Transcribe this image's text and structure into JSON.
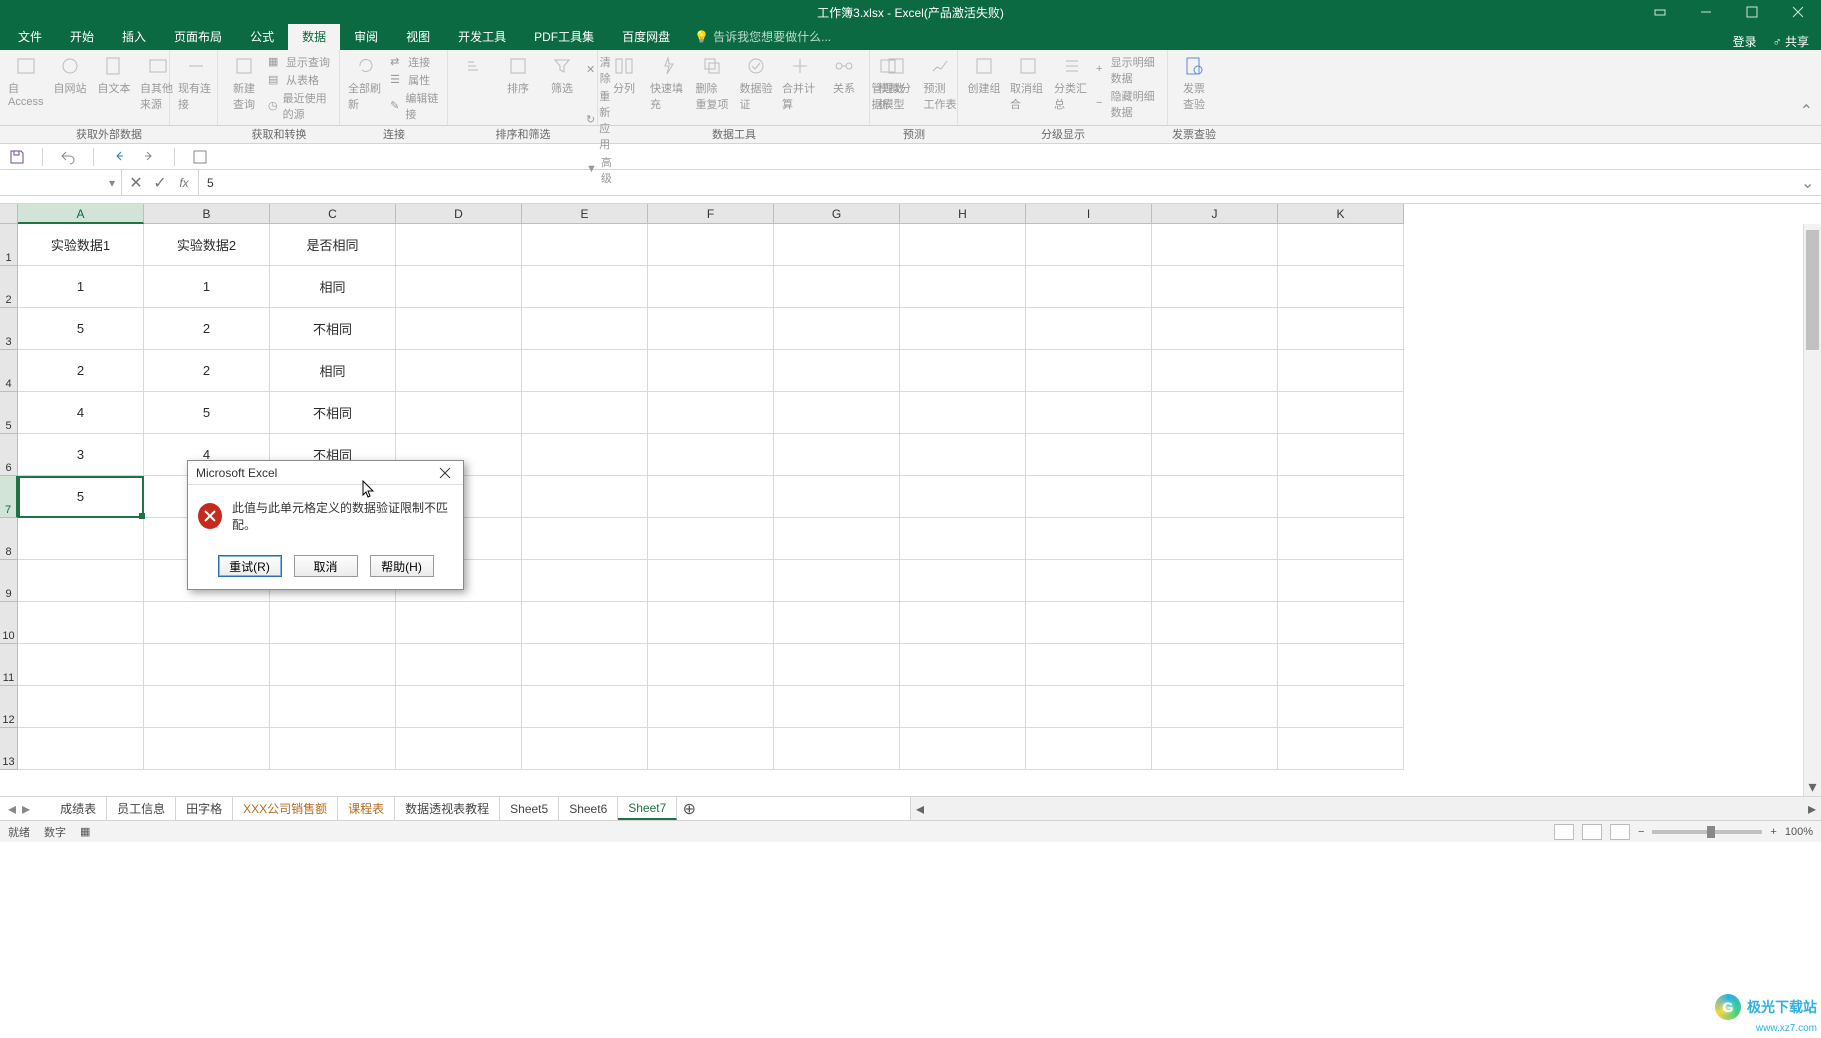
{
  "window": {
    "title": "工作簿3.xlsx - Excel(产品激活失败)"
  },
  "tabs": {
    "file": "文件",
    "home": "开始",
    "insert": "插入",
    "layout": "页面布局",
    "formula": "公式",
    "data": "数据",
    "review": "审阅",
    "view": "视图",
    "dev": "开发工具",
    "pdf": "PDF工具集",
    "baidu": "百度网盘",
    "tellme": "告诉我您想要做什么...",
    "login": "登录",
    "share": "共享"
  },
  "ribbon": {
    "external": {
      "access": "自 Access",
      "web": "自网站",
      "text": "自文本",
      "other": "自其他来源",
      "existing": "现有连接",
      "group": "获取外部数据"
    },
    "transform": {
      "newquery": "新建\n查询",
      "showq": "显示查询",
      "fromtable": "从表格",
      "recent": "最近使用的源",
      "group": "获取和转换"
    },
    "conn": {
      "refresh": "全部刷新",
      "connections": "连接",
      "props": "属性",
      "editlinks": "编辑链接",
      "group": "连接"
    },
    "sort": {
      "sort": "排序",
      "filter": "筛选",
      "clear": "清除",
      "reapply": "重新应用",
      "adv": "高级",
      "group": "排序和筛选"
    },
    "tools": {
      "t2c": "分列",
      "flash": "快速填充",
      "dup": "删除\n重复项",
      "valid": "数据验\n证",
      "consol": "合并计算",
      "rel": "关系",
      "model": "管理数\n据模型",
      "group": "数据工具"
    },
    "forecast": {
      "whatif": "模拟分析",
      "sheet": "预测\n工作表",
      "group": "预测"
    },
    "outline": {
      "make": "创建组",
      "unmake": "取消组合",
      "sub": "分类汇总",
      "showdetail": "显示明细数据",
      "hidedetail": "隐藏明细数据",
      "group": "分级显示"
    },
    "invoice": {
      "check": "发票\n查验",
      "group": "发票查验"
    }
  },
  "namebox": {
    "value": ""
  },
  "formula": {
    "value": "5",
    "fx": "fx"
  },
  "columns": [
    "A",
    "B",
    "C",
    "D",
    "E",
    "F",
    "G",
    "H",
    "I",
    "J",
    "K"
  ],
  "colWidths": {
    "A": 126,
    "B": 126,
    "C": 126,
    "rest": 126
  },
  "rowHeaders": [
    "1",
    "2",
    "3",
    "4",
    "5",
    "6",
    "7",
    "8",
    "9",
    "10",
    "11",
    "12",
    "13"
  ],
  "rowHeights": {
    "data": 42,
    "rest": 42
  },
  "cells": {
    "A1": "实验数据1",
    "B1": "实验数据2",
    "C1": "是否相同",
    "A2": "1",
    "B2": "1",
    "C2": "相同",
    "A3": "5",
    "B3": "2",
    "C3": "不相同",
    "A4": "2",
    "B4": "2",
    "C4": "相同",
    "A5": "4",
    "B5": "5",
    "C5": "不相同",
    "A6": "3",
    "B6": "4",
    "C6": "不相同",
    "A7": "5"
  },
  "activeCell": "A7",
  "sheets": {
    "list": [
      "成绩表",
      "员工信息",
      "田字格",
      "XXX公司销售额",
      "课程表",
      "数据透视表教程",
      "Sheet5",
      "Sheet6",
      "Sheet7"
    ],
    "active": "Sheet7",
    "highlighted": [
      "XXX公司销售额",
      "课程表"
    ]
  },
  "status": {
    "ready": "就绪",
    "num": "数字"
  },
  "zoom": {
    "value": "100%"
  },
  "dialog": {
    "title": "Microsoft Excel",
    "message": "此值与此单元格定义的数据验证限制不匹配。",
    "retry": "重试(R)",
    "cancel": "取消",
    "help": "帮助(H)"
  },
  "watermark": {
    "text": "极光下载站",
    "site": "www.xz7.com"
  }
}
